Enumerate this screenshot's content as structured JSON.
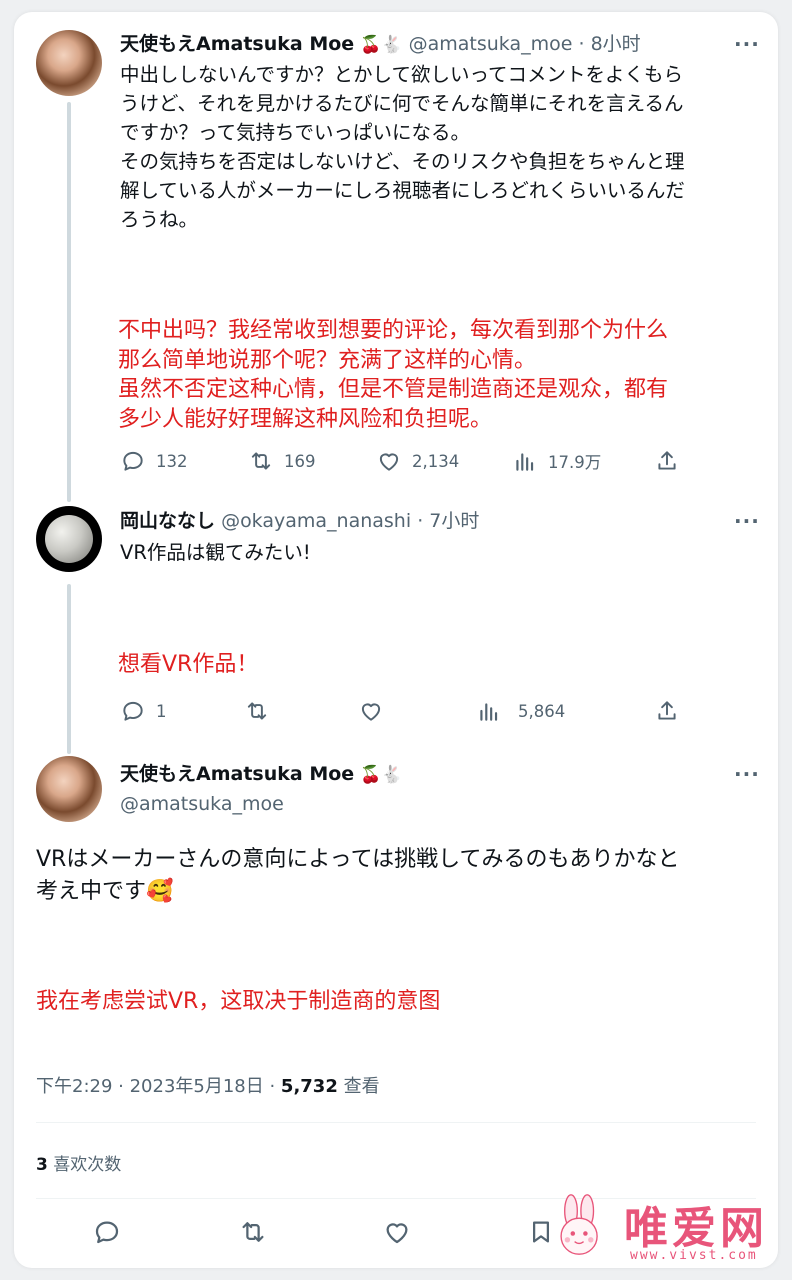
{
  "tweets": [
    {
      "name": "天使もえAmatsuka Moe",
      "handle": "@amatsuka_moe",
      "time": "8小时",
      "text": "中出ししないんですか？とかして欲しいってコメントをよくもら\nうけど、それを見かけるたびに何でそんな簡単にそれを言えるん\nですか？って気持ちでいっぱいになる。\nその気持ちを否定はしないけど、そのリスクや負担をちゃんと理\n解している人がメーカーにしろ視聴者にしろどれくらいいるんだ\nろうね。",
      "translation": "不中出吗？我经常收到想要的评论，每次看到那个为什么\n那么简单地说那个呢？充满了这样的心情。\n虽然不否定这种心情，但是不管是制造商还是观众，都有\n多少人能好好理解这种风险和负担呢。",
      "replies": "132",
      "retweets": "169",
      "likes": "2,134",
      "views": "17.9万"
    },
    {
      "name": "岡山ななし",
      "handle": "@okayama_nanashi",
      "time": "7小时",
      "text": "VR作品は観てみたい!",
      "translation": "想看VR作品！",
      "replies": "1",
      "views": "5,864"
    }
  ],
  "main_tweet": {
    "name": "天使もえAmatsuka Moe",
    "handle": "@amatsuka_moe",
    "text": "VRはメーカーさんの意向によっては挑戦してみるのもありかなと\n考え中です🥰",
    "translation": "我在考虑尝试VR，这取决于制造商的意图",
    "timestamp": "下午2:29 · 2023年5月18日 · ",
    "views_count": "5,732",
    "views_label": " 查看",
    "likes_count": "3",
    "likes_label": " 喜欢次数"
  },
  "separator": "·",
  "more_icon": "···",
  "cherry_emoji": "🍒",
  "rabbit_emoji": "🐇",
  "watermark": {
    "text": "唯爱网",
    "url": "www.vivst.com"
  },
  "colors": {
    "translation": "#e02020",
    "secondary_text": "#536471",
    "watermark": "#e8557a"
  }
}
